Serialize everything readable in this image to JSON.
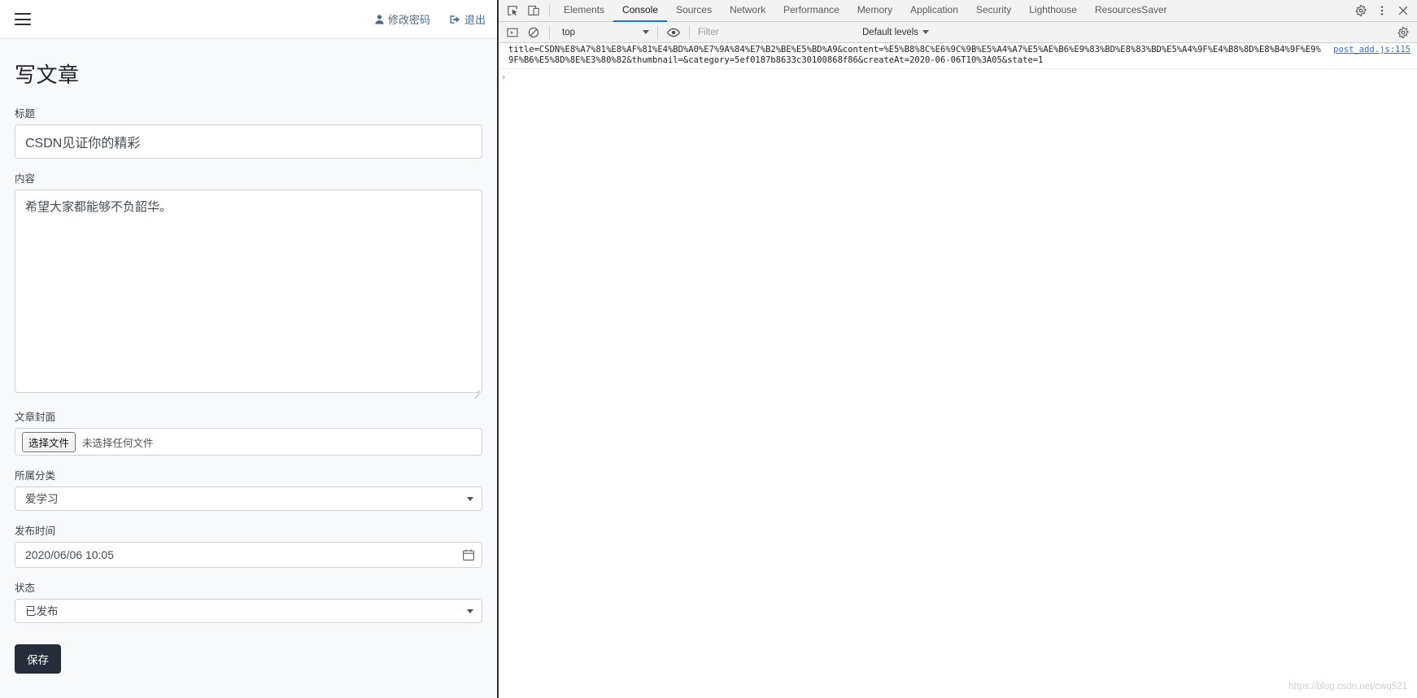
{
  "page": {
    "navbar": {
      "menu_icon": "hamburger-icon",
      "links": [
        {
          "icon": "user-icon",
          "label": "修改密码"
        },
        {
          "icon": "logout-icon",
          "label": "退出"
        }
      ]
    },
    "title": "写文章",
    "fields": {
      "title": {
        "label": "标题",
        "value": "CSDN见证你的精彩"
      },
      "content": {
        "label": "内容",
        "value": "希望大家都能够不负韶华。"
      },
      "cover": {
        "label": "文章封面",
        "button": "选择文件",
        "status": "未选择任何文件"
      },
      "category": {
        "label": "所属分类",
        "value": "爱学习"
      },
      "publish_time": {
        "label": "发布时间",
        "value": "2020/06/06 10:05"
      },
      "state": {
        "label": "状态",
        "value": "已发布"
      }
    },
    "save_button": "保存"
  },
  "devtools": {
    "toolbar_icons": {
      "inspect": "inspect-cursor-icon",
      "device": "device-toolbar-icon",
      "settings": "gear-icon",
      "more": "kebab-menu-icon",
      "close": "close-icon"
    },
    "tabs": [
      {
        "label": "Elements",
        "active": false
      },
      {
        "label": "Console",
        "active": true
      },
      {
        "label": "Sources",
        "active": false
      },
      {
        "label": "Network",
        "active": false
      },
      {
        "label": "Performance",
        "active": false
      },
      {
        "label": "Memory",
        "active": false
      },
      {
        "label": "Application",
        "active": false
      },
      {
        "label": "Security",
        "active": false
      },
      {
        "label": "Lighthouse",
        "active": false
      },
      {
        "label": "ResourcesSaver",
        "active": false
      }
    ],
    "console_toolbar": {
      "sidebar_icon": "console-sidebar-icon",
      "clear_icon": "clear-console-icon",
      "context": "top",
      "eye_icon": "live-expression-eye-icon",
      "filter_placeholder": "Filter",
      "filter_value": "",
      "levels": "Default levels",
      "settings_icon": "gear-icon"
    },
    "console_messages": [
      {
        "text": "title=CSDN%E8%A7%81%E8%AF%81%E4%BD%A0%E7%9A%84%E7%B2%BE%E5%BD%A9&content=%E5%B8%8C%E6%9C%9B%E5%A4%A7%E5%AE%B6%E9%83%BD%E8%83%BD%E5%A4%9F%E4%B8%8D%E8%B4%9F%E9%9F%B6%E5%8D%8E%E3%80%82&thumbnail=&category=5ef0187b8633c30100868f86&createAt=2020-06-06T10%3A05&state=1",
        "source": "post_add.js:115"
      }
    ],
    "prompt_symbol": "›",
    "watermark": "https://blog.csdn.net/cwq521"
  }
}
